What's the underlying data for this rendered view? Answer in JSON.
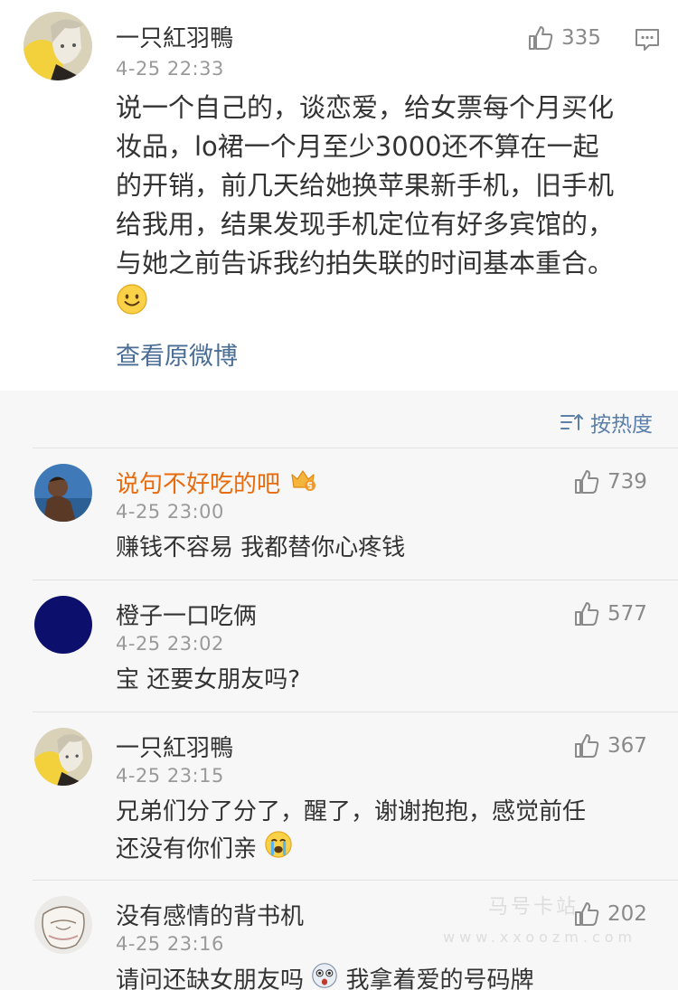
{
  "post": {
    "author": "一只紅羽鴨",
    "time": "4-25 22:33",
    "like_count": "335",
    "text_lines": [
      "说一个自己的，谈恋爱，给女票每个月买化",
      "妆品，lo裙一个月至少3000还不算在一起",
      "的开销，前几天给她换苹果新手机，旧手机",
      "给我用，结果发现手机定位有好多宾馆的，",
      "与她之前告诉我约拍失联的时间基本重合。"
    ],
    "trailing_emoji": "smile-emoji",
    "view_original_label": "查看原微博"
  },
  "sort": {
    "label": "按热度"
  },
  "comments": [
    {
      "name": "说句不好吃的吧",
      "badge": "crown-badge",
      "time": "4-25 23:00",
      "likes": "739",
      "lines": [
        "赚钱不容易 我都替你心疼钱"
      ]
    },
    {
      "name": "橙子一口吃俩",
      "time": "4-25 23:02",
      "likes": "577",
      "lines": [
        "宝 还要女朋友吗?"
      ]
    },
    {
      "name": "一只紅羽鴨",
      "time": "4-25 23:15",
      "likes": "367",
      "lines": [
        "兄弟们分了分了，醒了，谢谢抱抱，感觉前任",
        "还没有你们亲"
      ]
    },
    {
      "name": "没有感情的背书机",
      "time": "4-25 23:16",
      "likes": "202",
      "lines": [
        "请问还缺女朋友吗",
        "我拿着爱的号码牌"
      ]
    }
  ],
  "watermark": {
    "line1": "马号卡站",
    "line2": "www.xxoozm.com"
  },
  "colors": {
    "vip_name": "#e86b0e",
    "link": "#4a6d96",
    "sort": "#5b7fa8",
    "muted": "#9a9a9a"
  }
}
